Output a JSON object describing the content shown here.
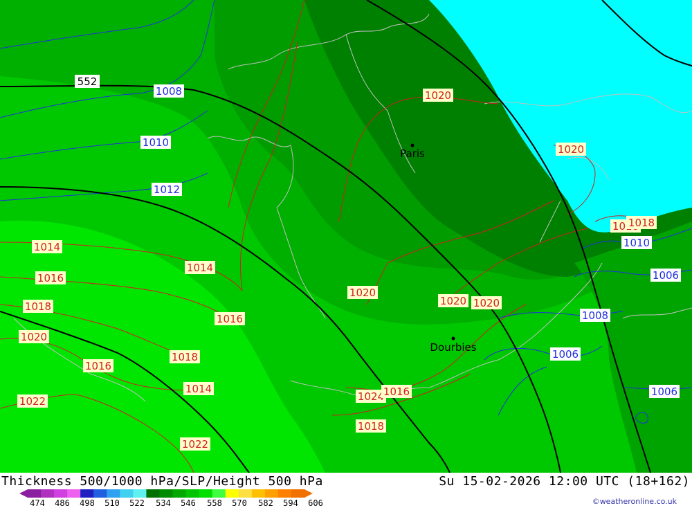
{
  "map": {
    "thickness_contours": [
      {
        "value": "552"
      }
    ],
    "pressure_labels": [
      {
        "value": "1008",
        "color": "#2030e0"
      },
      {
        "value": "1010",
        "color": "#2030e0"
      },
      {
        "value": "1012",
        "color": "#2030e0"
      },
      {
        "value": "1020",
        "color": "#d02020"
      },
      {
        "value": "1020",
        "color": "#d02020"
      },
      {
        "value": "1014",
        "color": "#d02020"
      },
      {
        "value": "1014",
        "color": "#d02020"
      },
      {
        "value": "1016",
        "color": "#d02020"
      },
      {
        "value": "1016",
        "color": "#d02020"
      },
      {
        "value": "1018",
        "color": "#d02020"
      },
      {
        "value": "1018",
        "color": "#d02020"
      },
      {
        "value": "1020",
        "color": "#d02020"
      },
      {
        "value": "1020",
        "color": "#d02020"
      },
      {
        "value": "1020",
        "color": "#d02020"
      },
      {
        "value": "1020",
        "color": "#d02020"
      },
      {
        "value": "1016",
        "color": "#d02020"
      },
      {
        "value": "1022",
        "color": "#d02020"
      },
      {
        "value": "1022",
        "color": "#d02020"
      },
      {
        "value": "1024",
        "color": "#d02020"
      },
      {
        "value": "1016",
        "color": "#d02020"
      },
      {
        "value": "1018",
        "color": "#d02020"
      },
      {
        "value": "1014",
        "color": "#d02020"
      },
      {
        "value": "1018",
        "color": "#d02020"
      },
      {
        "value": "1018",
        "color": "#d02020"
      },
      {
        "value": "1010",
        "color": "#2030e0"
      },
      {
        "value": "1006",
        "color": "#2030e0"
      },
      {
        "value": "1008",
        "color": "#2030e0"
      },
      {
        "value": "1006",
        "color": "#2030e0"
      },
      {
        "value": "1006",
        "color": "#2030e0"
      }
    ],
    "cities": [
      {
        "name": "Paris"
      },
      {
        "name": "Dourbies"
      }
    ],
    "colors": {
      "thickness_534": "#008000",
      "thickness_540": "#009a00",
      "thickness_546": "#00b400",
      "thickness_552": "#00cc00",
      "thickness_558": "#00e600",
      "sea": "#00ffff",
      "isobar_high": "#d02020",
      "isobar_low": "#2030e0",
      "borders": "#c0c0c0",
      "height_lines": "#000000"
    }
  },
  "footer": {
    "title_left": "Thickness 500/1000 hPa/SLP/Height 500 hPa",
    "title_right": "Su 15-02-2026 12:00 UTC (18+162)",
    "credit": "©weatheronline.co.uk",
    "scale_ticks": [
      "474",
      "486",
      "498",
      "510",
      "522",
      "534",
      "546",
      "558",
      "570",
      "582",
      "594",
      "606"
    ],
    "scale_colors": [
      "#8a20a0",
      "#b030c0",
      "#d040e0",
      "#ee60ee",
      "#2020c0",
      "#2060e0",
      "#30a0f0",
      "#40d0f0",
      "#60f0f0",
      "#007000",
      "#008c00",
      "#00a800",
      "#00c400",
      "#00e000",
      "#40ff40",
      "#ffff00",
      "#ffe040",
      "#ffc000",
      "#ffa000",
      "#ff8000",
      "#f07000"
    ]
  }
}
